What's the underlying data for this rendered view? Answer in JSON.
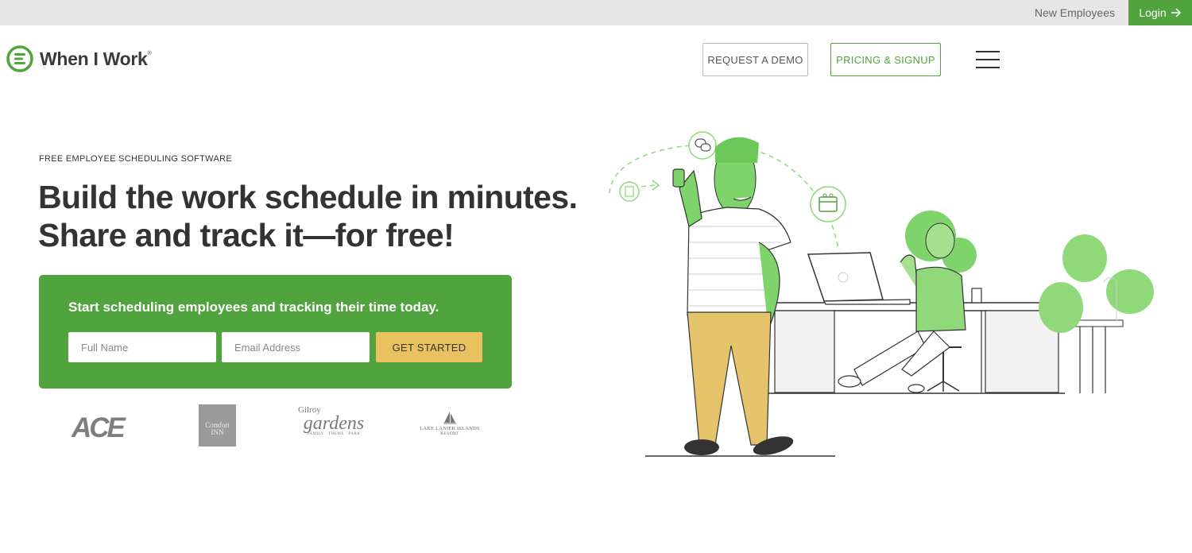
{
  "topbar": {
    "new_employees": "New Employees",
    "login": "Login"
  },
  "header": {
    "logo_text": "When I Work",
    "logo_trademark": "®",
    "request_demo": "REQUEST A DEMO",
    "pricing_signup": "PRICING & SIGNUP"
  },
  "hero": {
    "eyebrow": "FREE EMPLOYEE SCHEDULING SOFTWARE",
    "headline_line1": "Build the work schedule in minutes.",
    "headline_line2": "Share and track it—for free!"
  },
  "signup": {
    "title": "Start scheduling employees and tracking their time today.",
    "name_placeholder": "Full Name",
    "email_placeholder": "Email Address",
    "cta": "GET STARTED"
  },
  "clients": {
    "ace": "ACE",
    "comfort_line1": "Comfort",
    "comfort_line2": "INN",
    "gilroy_line1": "Gilroy",
    "gilroy_line2": "gardens",
    "gilroy_line3": "FAMILY · THEME · PARK",
    "lake_line1": "LAKE LANIER ISLANDS",
    "lake_line2": "RESORT"
  },
  "colors": {
    "brand_green": "#51a33d",
    "illustration_green": "#7ed36a",
    "cta_yellow": "#e9c25f",
    "topbar_gray": "#e6e6e6"
  },
  "icons": [
    "logo-mark-icon",
    "arrow-right-icon",
    "hamburger-menu-icon",
    "chat-bubble-icon",
    "document-icon",
    "calendar-icon"
  ]
}
